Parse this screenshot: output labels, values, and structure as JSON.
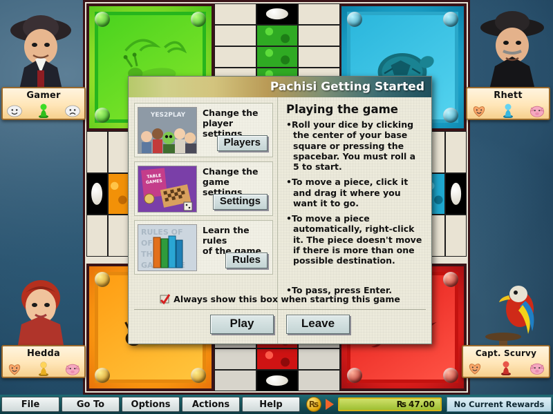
{
  "window": {
    "title": "Pachisi Getting Started"
  },
  "dialog": {
    "options": [
      {
        "id": "players",
        "thumb_caption": "YES2PLAY",
        "desc": "Change the\nplayer settings",
        "desc_line1": "Change the",
        "desc_line2": "player settings",
        "button": "Players",
        "icon": "players-thumbnail"
      },
      {
        "id": "settings",
        "thumb_caption": "TABLE GAMES",
        "desc_line1": "Change the",
        "desc_line2": "game settings",
        "button": "Settings",
        "icon": "settings-thumbnail"
      },
      {
        "id": "rules",
        "thumb_caption": "RULES OF THE GAME",
        "desc_line1": "Learn the rules",
        "desc_line2": "of the game",
        "button": "Rules",
        "icon": "rules-thumbnail"
      }
    ],
    "help": {
      "heading": "Playing the game",
      "bullets": [
        "Roll your dice by clicking the center of your base square or pressing the spacebar. You must roll a 5 to start.",
        "To move a piece, click it and drag it where you want it to go.",
        "To move a piece automatically, right-click it. The piece doesn't move if there is more than one possible destination.",
        "To pass, press Enter."
      ]
    },
    "checkbox": {
      "label": "Always show this box when starting this game",
      "checked": true
    },
    "buttons": {
      "play": "Play",
      "leave": "Leave"
    }
  },
  "players": [
    {
      "name": "Gamer",
      "piece_color": "#2fbf1c",
      "mood_left": "smiley-icon",
      "mood_right": "frown-icon",
      "position": "top-left"
    },
    {
      "name": "Rhett",
      "piece_color": "#39b7e0",
      "mood_left": "heart-icon",
      "mood_right": "pig-icon",
      "position": "top-right"
    },
    {
      "name": "Hedda",
      "piece_color": "#e8b020",
      "mood_left": "heart-icon",
      "mood_right": "pig-icon",
      "position": "bottom-left"
    },
    {
      "name": "Capt. Scurvy",
      "piece_color": "#c8302a",
      "mood_left": "heart-icon",
      "mood_right": "pig-icon",
      "position": "bottom-right"
    }
  ],
  "board": {
    "quadrants": [
      {
        "color_name": "green",
        "hex": "#49c41a",
        "motif": "grasshopper"
      },
      {
        "color_name": "blue",
        "hex": "#1fa8cf",
        "motif": "turtle"
      },
      {
        "color_name": "orange",
        "hex": "#f29108",
        "motif": "bee"
      },
      {
        "color_name": "red",
        "hex": "#e8201c",
        "motif": "bird"
      }
    ]
  },
  "toolbar": {
    "menus": [
      "File",
      "Go To",
      "Options",
      "Actions",
      "Help"
    ],
    "coin_symbol": "₨",
    "currency_symbol": "₨",
    "balance": "47.00",
    "rewards_text": "No Current Rewards"
  }
}
